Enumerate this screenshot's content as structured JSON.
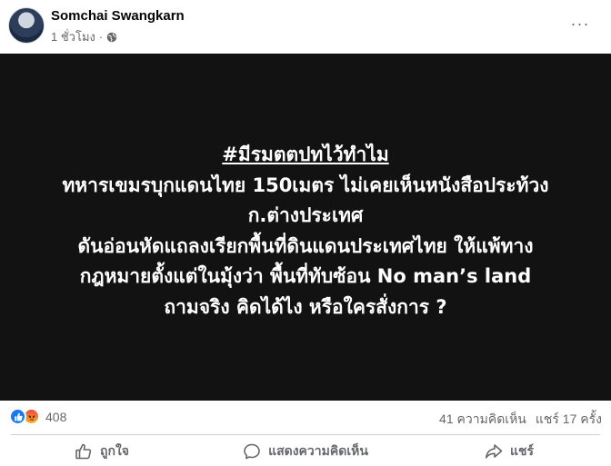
{
  "post": {
    "author": "Somchai Swangkarn",
    "time": "1 ชั่วโมง",
    "separator": "·",
    "more": "···"
  },
  "image_text": {
    "hashtag": "#มีรมตตปทไว้ทำไม",
    "lines": [
      "ทหารเขมรบุกแดนไทย 150เมตร ไม่เคยเห็นหนังสือประท้วง",
      "ก.ต่างประเทศ",
      "ดันอ่อนหัดแถลงเรียกพื้นที่ดินแดนประเทศไทย ให้แพ้ทาง",
      "กฎหมายตั้งแต่ในมุ้งว่า พื้นที่ทับซ้อน No man’s land",
      "ถามจริง คิดได้ไง หรือใครสั่งการ ?"
    ]
  },
  "stats": {
    "reaction_count": "408",
    "comments": "41 ความคิดเห็น",
    "shares": "แชร์ 17 ครั้ง"
  },
  "actions": {
    "like": "ถูกใจ",
    "comment": "แสดงความคิดเห็น",
    "share": "แชร์"
  },
  "icons": {
    "privacy": "globe-icon",
    "like_reaction": "like-reaction-icon",
    "angry_reaction": "angry-reaction-icon",
    "like_action": "thumbs-up-icon",
    "comment_action": "comment-icon",
    "share_action": "share-icon"
  },
  "colors": {
    "media_background": "#121212",
    "meta_text": "#65676b",
    "like_blue": "#1877f2"
  }
}
